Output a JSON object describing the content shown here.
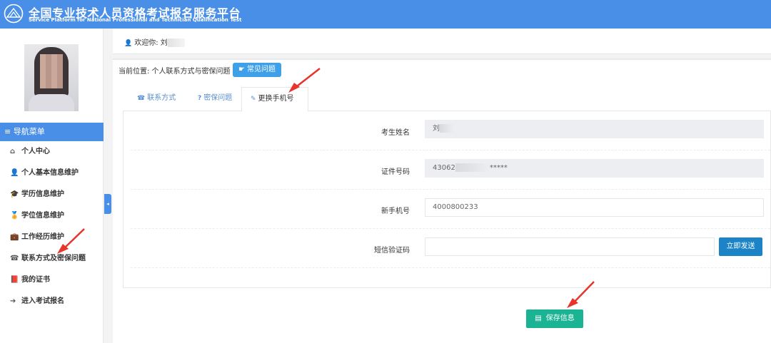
{
  "header": {
    "title_cn": "全国专业技术人员资格考试报名服务平台",
    "title_en": "Service Platform for National Professional and Technician Qualification Test"
  },
  "sidebar": {
    "nav_header": "≡ 导航菜单",
    "items": [
      {
        "icon": "home-icon",
        "glyph": "⌂",
        "label": "个人中心"
      },
      {
        "icon": "user-icon",
        "glyph": "👤",
        "label": "个人基本信息维护"
      },
      {
        "icon": "graduation-cap-icon",
        "glyph": "🎓",
        "label": "学历信息维护"
      },
      {
        "icon": "medal-icon",
        "glyph": "🏅",
        "label": "学位信息维护"
      },
      {
        "icon": "briefcase-icon",
        "glyph": "💼",
        "label": "工作经历维护"
      },
      {
        "icon": "phone-icon",
        "glyph": "☎",
        "label": "联系方式及密保问题"
      },
      {
        "icon": "book-icon",
        "glyph": "📕",
        "label": "我的证书"
      },
      {
        "icon": "arrow-circle-icon",
        "glyph": "➔",
        "label": "进入考试报名"
      }
    ],
    "toggle": "◂"
  },
  "welcome": {
    "prefix": "欢迎你: ",
    "name": "刘"
  },
  "breadcrumb": {
    "text": "当前位置: 个人联系方式与密保问题",
    "faq_label": "常见问题"
  },
  "tabs": [
    {
      "label": "联系方式",
      "icon": "phone-icon",
      "glyph": "☎"
    },
    {
      "label": "密保问题",
      "icon": "question-icon",
      "glyph": "?"
    },
    {
      "label": "更换手机号",
      "icon": "pencil-icon",
      "glyph": "✎"
    }
  ],
  "form": {
    "name_label": "考生姓名",
    "name_value": "刘",
    "id_label": "证件号码",
    "id_prefix": "43062",
    "id_suffix": "*****",
    "phone_label": "新手机号",
    "phone_value": "4000800233",
    "sms_label": "短信验证码",
    "sms_value": "",
    "send_label": "立即发送"
  },
  "save": {
    "label": "保存信息"
  },
  "colors": {
    "header": "#4a8fe7",
    "save": "#1ab394",
    "send": "#1c84c6",
    "annotation": "#e8342b"
  }
}
